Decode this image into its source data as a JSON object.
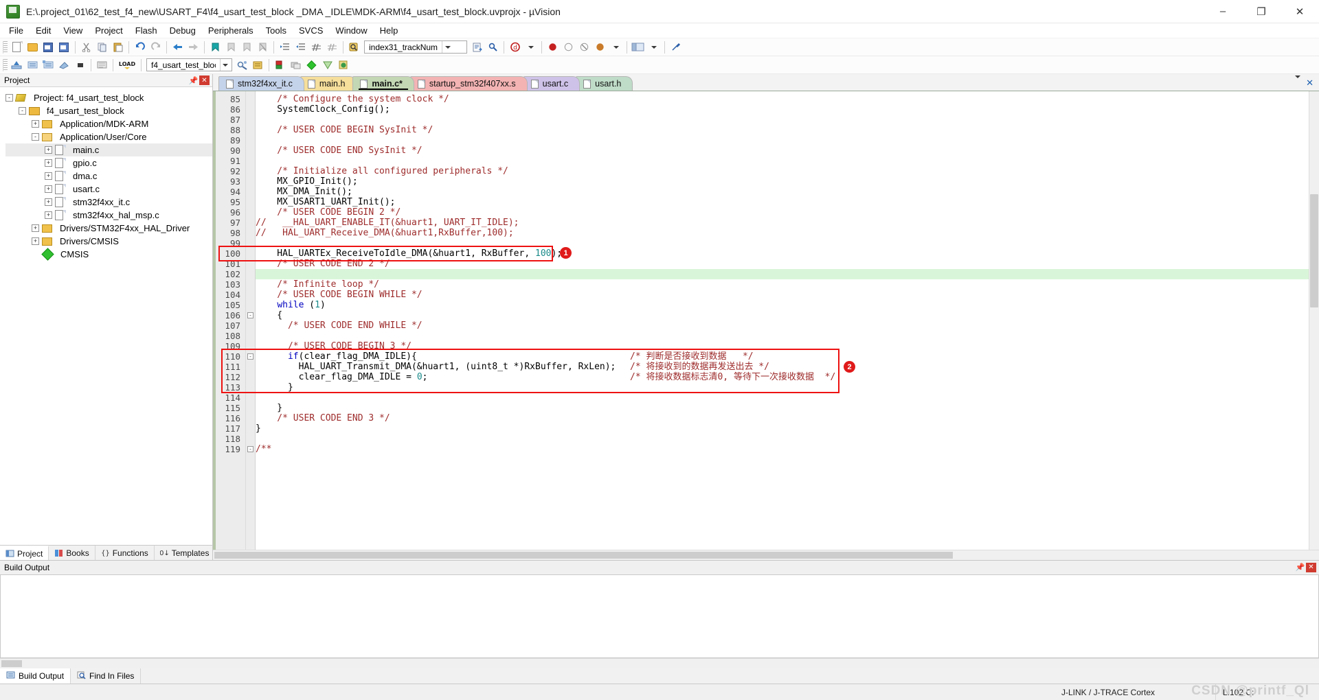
{
  "window": {
    "title": "E:\\.project_01\\62_test_f4_new\\USART_F4\\f4_usart_test_block _DMA _IDLE\\MDK-ARM\\f4_usart_test_block.uvprojx - µVision",
    "app_icon": "uvision-icon",
    "minimize": "–",
    "maximize": "❐",
    "close": "✕"
  },
  "menu": [
    "File",
    "Edit",
    "View",
    "Project",
    "Flash",
    "Debug",
    "Peripherals",
    "Tools",
    "SVCS",
    "Window",
    "Help"
  ],
  "toolbar1": {
    "function_combo_value": "index31_trackNum",
    "icons": [
      "new-file-icon",
      "open-file-icon",
      "save-icon",
      "save-all-icon",
      "cut-icon",
      "copy-icon",
      "paste-icon",
      "undo-icon",
      "redo-icon",
      "back-icon",
      "forward-icon",
      "bookmark-toggle-icon",
      "bookmark-prev-icon",
      "bookmark-next-icon",
      "bookmark-clear-icon",
      "indent-icon",
      "outdent-icon",
      "comment-icon",
      "uncomment-icon",
      "find-in-files-icon",
      "go-to-definition-icon",
      "find-icon",
      "debug-icon",
      "insert-bookmark-icon",
      "breakpoint-icon",
      "disable-breakpoint-icon",
      "kill-breakpoints-icon",
      "enable-breakpoints-icon",
      "window-layout-icon",
      "configure-icon"
    ]
  },
  "toolbar2": {
    "target_combo_value": "f4_usart_test_block",
    "icons": [
      "build-icon",
      "rebuild-icon",
      "batch-build-icon",
      "translate-icon",
      "stop-build-icon",
      "download-icon",
      "target-options-icon",
      "manage-project-items-icon",
      "pack-installer-icon",
      "run-time-env-icon",
      "manage-run-time-env-icon"
    ]
  },
  "project_panel": {
    "header": "Project",
    "pin_icon": "pin-icon",
    "close_icon": "close-icon",
    "tree": [
      {
        "label": "Project: f4_usart_test_block",
        "icon": "project-icon",
        "depth": 0,
        "expander": "-",
        "selected": false
      },
      {
        "label": "f4_usart_test_block",
        "icon": "target-icon",
        "depth": 1,
        "expander": "-",
        "selected": false
      },
      {
        "label": "Application/MDK-ARM",
        "icon": "folder-icon",
        "depth": 2,
        "expander": "+",
        "selected": false
      },
      {
        "label": "Application/User/Core",
        "icon": "folder-open-icon",
        "depth": 2,
        "expander": "-",
        "selected": false
      },
      {
        "label": "main.c",
        "icon": "c-file-icon",
        "depth": 3,
        "expander": "+",
        "selected": true
      },
      {
        "label": "gpio.c",
        "icon": "c-file-icon",
        "depth": 3,
        "expander": "+",
        "selected": false
      },
      {
        "label": "dma.c",
        "icon": "c-file-icon",
        "depth": 3,
        "expander": "+",
        "selected": false
      },
      {
        "label": "usart.c",
        "icon": "c-file-icon",
        "depth": 3,
        "expander": "+",
        "selected": false
      },
      {
        "label": "stm32f4xx_it.c",
        "icon": "c-file-icon",
        "depth": 3,
        "expander": "+",
        "selected": false
      },
      {
        "label": "stm32f4xx_hal_msp.c",
        "icon": "c-file-icon",
        "depth": 3,
        "expander": "+",
        "selected": false
      },
      {
        "label": "Drivers/STM32F4xx_HAL_Driver",
        "icon": "folder-icon",
        "depth": 2,
        "expander": "+",
        "selected": false
      },
      {
        "label": "Drivers/CMSIS",
        "icon": "folder-icon",
        "depth": 2,
        "expander": "+",
        "selected": false
      },
      {
        "label": "CMSIS",
        "icon": "cmsis-icon",
        "depth": 2,
        "expander": "",
        "selected": false
      }
    ],
    "bottom_tabs": [
      {
        "label": "Project",
        "icon": "project-tab-icon",
        "active": true
      },
      {
        "label": "Books",
        "icon": "books-tab-icon",
        "active": false
      },
      {
        "label": "Functions",
        "icon": "functions-tab-icon",
        "active": false
      },
      {
        "label": "Templates",
        "icon": "templates-tab-icon",
        "active": false
      }
    ]
  },
  "editor": {
    "tabs": [
      {
        "label": "stm32f4xx_it.c",
        "color": "#c5d3ea",
        "active": false,
        "modified": false
      },
      {
        "label": "main.h",
        "color": "#f6de9b",
        "active": false,
        "modified": false
      },
      {
        "label": "main.c*",
        "color": "#c3d7b4",
        "active": true,
        "modified": true
      },
      {
        "label": "startup_stm32f407xx.s",
        "color": "#f3b3b3",
        "active": false,
        "modified": false
      },
      {
        "label": "usart.c",
        "color": "#cfc2e8",
        "active": false,
        "modified": false
      },
      {
        "label": "usart.h",
        "color": "#bfdcc8",
        "active": false,
        "modified": false
      }
    ],
    "tab_nav": {
      "down_icon": "chevron-down-icon",
      "close_icon": "close-icon"
    },
    "first_line_number": 85,
    "lines": [
      {
        "n": 85,
        "fold": "",
        "hl": false,
        "segs": [
          {
            "t": "    /* Configure the system clock */",
            "c": "cm"
          }
        ]
      },
      {
        "n": 86,
        "fold": "",
        "hl": false,
        "segs": [
          {
            "t": "    SystemClock_Config();",
            "c": ""
          }
        ]
      },
      {
        "n": 87,
        "fold": "",
        "hl": false,
        "segs": [
          {
            "t": "",
            "c": ""
          }
        ]
      },
      {
        "n": 88,
        "fold": "",
        "hl": false,
        "segs": [
          {
            "t": "    /* USER CODE BEGIN SysInit */",
            "c": "cm"
          }
        ]
      },
      {
        "n": 89,
        "fold": "",
        "hl": false,
        "segs": [
          {
            "t": "",
            "c": ""
          }
        ]
      },
      {
        "n": 90,
        "fold": "",
        "hl": false,
        "segs": [
          {
            "t": "    /* USER CODE END SysInit */",
            "c": "cm"
          }
        ]
      },
      {
        "n": 91,
        "fold": "",
        "hl": false,
        "segs": [
          {
            "t": "",
            "c": ""
          }
        ]
      },
      {
        "n": 92,
        "fold": "",
        "hl": false,
        "segs": [
          {
            "t": "    /* Initialize all configured peripherals */",
            "c": "cm"
          }
        ]
      },
      {
        "n": 93,
        "fold": "",
        "hl": false,
        "segs": [
          {
            "t": "    MX_GPIO_Init();",
            "c": ""
          }
        ]
      },
      {
        "n": 94,
        "fold": "",
        "hl": false,
        "segs": [
          {
            "t": "    MX_DMA_Init();",
            "c": ""
          }
        ]
      },
      {
        "n": 95,
        "fold": "",
        "hl": false,
        "segs": [
          {
            "t": "    MX_USART1_UART_Init();",
            "c": ""
          }
        ]
      },
      {
        "n": 96,
        "fold": "",
        "hl": false,
        "segs": [
          {
            "t": "    /* USER CODE BEGIN 2 */",
            "c": "cm"
          }
        ]
      },
      {
        "n": 97,
        "fold": "",
        "hl": false,
        "segs": [
          {
            "t": "//   __HAL_UART_ENABLE_IT(&huart1, UART_IT_IDLE);",
            "c": "cm"
          }
        ]
      },
      {
        "n": 98,
        "fold": "",
        "hl": false,
        "segs": [
          {
            "t": "//   HAL_UART_Receive_DMA(&huart1,RxBuffer,100);",
            "c": "cm"
          }
        ]
      },
      {
        "n": 99,
        "fold": "",
        "hl": false,
        "segs": [
          {
            "t": "",
            "c": ""
          }
        ]
      },
      {
        "n": 100,
        "fold": "",
        "hl": false,
        "segs": [
          {
            "t": "    HAL_UARTEx_ReceiveToIdle_DMA(&huart1, RxBuffer, ",
            "c": ""
          },
          {
            "t": "100",
            "c": "num"
          },
          {
            "t": ");",
            "c": ""
          }
        ]
      },
      {
        "n": 101,
        "fold": "",
        "hl": false,
        "segs": [
          {
            "t": "    /* USER CODE END 2 */",
            "c": "cm"
          }
        ]
      },
      {
        "n": 102,
        "fold": "",
        "hl": true,
        "segs": [
          {
            "t": "",
            "c": ""
          }
        ]
      },
      {
        "n": 103,
        "fold": "",
        "hl": false,
        "segs": [
          {
            "t": "    /* Infinite loop */",
            "c": "cm"
          }
        ]
      },
      {
        "n": 104,
        "fold": "",
        "hl": false,
        "segs": [
          {
            "t": "    /* USER CODE BEGIN WHILE */",
            "c": "cm"
          }
        ]
      },
      {
        "n": 105,
        "fold": "",
        "hl": false,
        "segs": [
          {
            "t": "    ",
            "c": ""
          },
          {
            "t": "while",
            "c": "kw"
          },
          {
            "t": " (",
            "c": ""
          },
          {
            "t": "1",
            "c": "num"
          },
          {
            "t": ")",
            "c": ""
          }
        ]
      },
      {
        "n": 106,
        "fold": "-",
        "hl": false,
        "segs": [
          {
            "t": "    {",
            "c": ""
          }
        ]
      },
      {
        "n": 107,
        "fold": "",
        "hl": false,
        "segs": [
          {
            "t": "      /* USER CODE END WHILE */",
            "c": "cm"
          }
        ]
      },
      {
        "n": 108,
        "fold": "",
        "hl": false,
        "segs": [
          {
            "t": "",
            "c": ""
          }
        ]
      },
      {
        "n": 109,
        "fold": "",
        "hl": false,
        "segs": [
          {
            "t": "      /* USER CODE BEGIN 3 */",
            "c": "cm"
          }
        ]
      },
      {
        "n": 110,
        "fold": "-",
        "hl": false,
        "segs": [
          {
            "t": "      ",
            "c": ""
          },
          {
            "t": "if",
            "c": "kw"
          },
          {
            "t": "(clear_flag_DMA_IDLE){",
            "c": ""
          }
        ]
      },
      {
        "n": 111,
        "fold": "",
        "hl": false,
        "segs": [
          {
            "t": "        HAL_UART_Transmit_DMA(&huart1, (uint8_t *)RxBuffer, RxLen);",
            "c": ""
          }
        ]
      },
      {
        "n": 112,
        "fold": "",
        "hl": false,
        "segs": [
          {
            "t": "        clear_flag_DMA_IDLE = ",
            "c": ""
          },
          {
            "t": "0",
            "c": "num"
          },
          {
            "t": ";",
            "c": ""
          }
        ]
      },
      {
        "n": 113,
        "fold": "",
        "hl": false,
        "segs": [
          {
            "t": "      }",
            "c": ""
          }
        ]
      },
      {
        "n": 114,
        "fold": "",
        "hl": false,
        "segs": [
          {
            "t": "",
            "c": ""
          }
        ]
      },
      {
        "n": 115,
        "fold": "",
        "hl": false,
        "segs": [
          {
            "t": "    }",
            "c": ""
          }
        ]
      },
      {
        "n": 116,
        "fold": "",
        "hl": false,
        "segs": [
          {
            "t": "    /* USER CODE END 3 */",
            "c": "cm"
          }
        ]
      },
      {
        "n": 117,
        "fold": "",
        "hl": false,
        "segs": [
          {
            "t": "}",
            "c": ""
          }
        ]
      },
      {
        "n": 118,
        "fold": "",
        "hl": false,
        "segs": [
          {
            "t": "",
            "c": ""
          }
        ]
      },
      {
        "n": 119,
        "fold": "-",
        "hl": false,
        "segs": [
          {
            "t": "/**",
            "c": "cm"
          }
        ]
      }
    ],
    "side_comments": [
      {
        "line": 110,
        "text": "/* 判断是否接收到数据   */"
      },
      {
        "line": 111,
        "text": "/* 将接收到的数据再发送出去 */"
      },
      {
        "line": 112,
        "text": "/* 将接收数据标志清0, 等待下一次接收数据  */"
      }
    ],
    "annotations": [
      {
        "id": "1",
        "badge": "1"
      },
      {
        "id": "2",
        "badge": "2"
      }
    ]
  },
  "build_output": {
    "header": "Build Output",
    "pin_icon": "pin-icon",
    "close_icon": "close-icon",
    "content": "",
    "tabs": [
      {
        "label": "Build Output",
        "icon": "build-output-icon",
        "active": true
      },
      {
        "label": "Find In Files",
        "icon": "find-in-files-icon",
        "active": false
      }
    ]
  },
  "statusbar": {
    "left": "",
    "debugger": "J-LINK / J-TRACE Cortex",
    "caret": "L:102 C:",
    "watermark": "CSDN @printf_Ql"
  },
  "colors": {
    "comment": "#9e2b2b",
    "keyword": "#0000c0",
    "number": "#1a8a8a",
    "annotation_red": "#ee1111",
    "highlight_green": "#d9f5d9",
    "selection_gray": "#ebebeb"
  }
}
